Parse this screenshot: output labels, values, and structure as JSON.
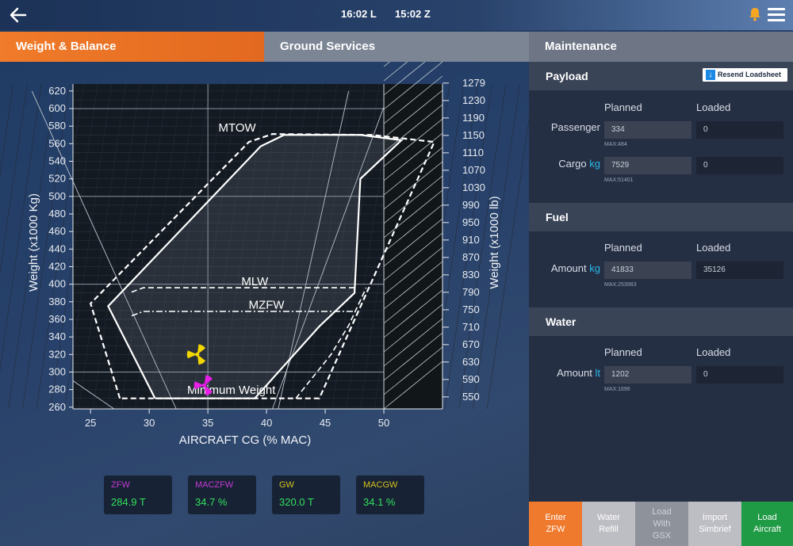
{
  "topbar": {
    "local_time": "16:02 L",
    "zulu_time": "15:02 Z",
    "icons": [
      "back-arrow-icon",
      "bell-icon",
      "hamburger-menu-icon"
    ]
  },
  "tabs": [
    {
      "label": "Weight & Balance",
      "active": true
    },
    {
      "label": "Ground Services",
      "active": false
    },
    {
      "label": "Maintenance",
      "active": false
    }
  ],
  "chart_data": {
    "type": "line",
    "xlabel": "AIRCRAFT CG (% MAC)",
    "ylabel_left": "Weight (x1000 Kg)",
    "ylabel_right": "Weight (x1000 lb)",
    "xlim": [
      23.5,
      55
    ],
    "ylim": [
      258,
      628
    ],
    "x_ticks": [
      "25",
      "30",
      "35",
      "40",
      "45",
      "50"
    ],
    "y_ticks_left": [
      "620",
      "600",
      "580",
      "560",
      "540",
      "520",
      "500",
      "480",
      "460",
      "440",
      "420",
      "400",
      "380",
      "360",
      "340",
      "320",
      "300",
      "280",
      "260"
    ],
    "y_ticks_right": [
      "1279",
      "1230",
      "1190",
      "1150",
      "1110",
      "1070",
      "1030",
      "990",
      "950",
      "910",
      "870",
      "830",
      "790",
      "750",
      "710",
      "670",
      "630",
      "590",
      "550"
    ],
    "envelope_labels": [
      "MTOW",
      "MLW",
      "MZFW",
      "Minimum Weight"
    ],
    "series": [
      {
        "name": "MTOW",
        "style": "dashed",
        "points": [
          [
            27.5,
            270
          ],
          [
            25.0,
            378
          ],
          [
            38.5,
            562
          ],
          [
            40.5,
            571
          ],
          [
            49.0,
            570
          ],
          [
            54.3,
            562
          ],
          [
            44.5,
            270
          ],
          [
            27.5,
            270
          ]
        ]
      },
      {
        "name": "MLW",
        "style": "dashed",
        "points": [
          [
            28.5,
            391
          ],
          [
            29.5,
            396
          ],
          [
            47.5,
            396
          ]
        ]
      },
      {
        "name": "MZFW",
        "style": "dash-dot",
        "points": [
          [
            28.5,
            364
          ],
          [
            29.5,
            369
          ],
          [
            47.5,
            369
          ]
        ]
      },
      {
        "name": "Operating envelope",
        "style": "solid",
        "points": [
          [
            30.5,
            270
          ],
          [
            26.5,
            375
          ],
          [
            39.5,
            557
          ],
          [
            41.5,
            570
          ],
          [
            48.0,
            570
          ],
          [
            51.5,
            564
          ],
          [
            48.0,
            520
          ],
          [
            47.5,
            390
          ],
          [
            44.5,
            352
          ],
          [
            39.0,
            270
          ],
          [
            30.5,
            270
          ]
        ]
      },
      {
        "name": "Landing envelope",
        "style": "dashed",
        "points": [
          [
            42.5,
            270
          ],
          [
            45.5,
            320
          ],
          [
            47.0,
            353
          ],
          [
            48.5,
            396
          ]
        ]
      }
    ],
    "markers": [
      {
        "name": "GW",
        "x": 34.1,
        "y": 320.0,
        "color": "#f2d600"
      },
      {
        "name": "ZFW",
        "x": 34.7,
        "y": 284.9,
        "color": "#e61ee6"
      }
    ]
  },
  "stats": [
    {
      "label": "ZFW",
      "value": "284.9 T",
      "label_color": "#c43ad4"
    },
    {
      "label": "MACZFW",
      "value": "34.7 %",
      "label_color": "#c43ad4"
    },
    {
      "label": "GW",
      "value": "320.0 T",
      "label_color": "#d6c21a"
    },
    {
      "label": "MACGW",
      "value": "34.1 %",
      "label_color": "#d6c21a"
    }
  ],
  "payload": {
    "title": "Payload",
    "resend_label": "Resend Loadsheet",
    "planned_header": "Planned",
    "loaded_header": "Loaded",
    "passenger": {
      "label": "Passenger",
      "planned": "334",
      "loaded": "0",
      "max": "MAX:484"
    },
    "cargo": {
      "label": "Cargo",
      "unit": "kg",
      "planned": "7529",
      "loaded": "0",
      "max": "MAX:51401"
    }
  },
  "fuel": {
    "title": "Fuel",
    "planned_header": "Planned",
    "loaded_header": "Loaded",
    "amount": {
      "label": "Amount",
      "unit": "kg",
      "planned": "41833",
      "loaded": "35126",
      "max": "MAX:253983"
    }
  },
  "water": {
    "title": "Water",
    "planned_header": "Planned",
    "loaded_header": "Loaded",
    "amount": {
      "label": "Amount",
      "unit": "lt",
      "planned": "1202",
      "loaded": "0",
      "max": "MAX:1696"
    }
  },
  "actions": [
    {
      "line1": "Enter",
      "line2": "ZFW",
      "line3": ""
    },
    {
      "line1": "Water",
      "line2": "Refill",
      "line3": ""
    },
    {
      "line1": "Load",
      "line2": "With",
      "line3": "GSX"
    },
    {
      "line1": "Import",
      "line2": "Simbrief",
      "line3": ""
    },
    {
      "line1": "Load",
      "line2": "Aircraft",
      "line3": ""
    }
  ],
  "colors": {
    "accent_orange": "#ef7a2d",
    "success_green": "#1f9a45",
    "value_green": "#33e15c",
    "link_blue": "#2ab6e8"
  }
}
